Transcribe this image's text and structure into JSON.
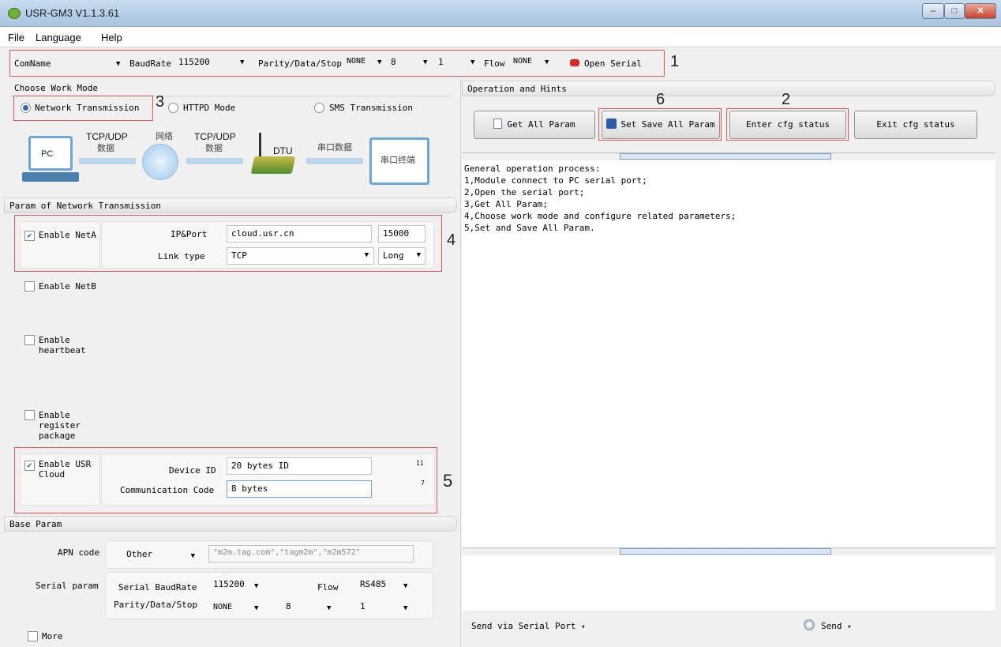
{
  "window": {
    "title": "USR-GM3 V1.1.3.61",
    "min": "–",
    "max": "□",
    "close": "✕"
  },
  "menu": [
    "File",
    "Language",
    "Help"
  ],
  "toolbar": {
    "comname_label": "ComName",
    "comname_value": "",
    "baudrate_label": "BaudRate",
    "baudrate_value": "115200",
    "parity_label": "Parity/Data/Stop",
    "parity_value": "NONE",
    "data_value": "8",
    "stop_value": "1",
    "flow_label": "Flow",
    "flow_value": "NONE",
    "open_serial": "Open Serial",
    "status_color": "#d42a2a"
  },
  "callouts": {
    "c1": "1",
    "c2": "2",
    "c3": "3",
    "c4": "4",
    "c5": "5",
    "c6": "6"
  },
  "workmode": {
    "header": "Choose Work Mode",
    "network": "Network Transmission",
    "httpd": "HTTPD Mode",
    "sms": "SMS Transmission",
    "selected": "network"
  },
  "diagram": {
    "pc": "PC",
    "tcp1": "TCP/UDP",
    "data1": "数据",
    "net": "网络",
    "tcp2": "TCP/UDP",
    "data2": "数据",
    "dtu": "DTU",
    "serial_data": "串口数据",
    "terminal": "串口终端"
  },
  "net_params": {
    "header": "Param of Network Transmission",
    "neta_label": "Enable NetA",
    "neta_checked": true,
    "ipport_label": "IP&Port",
    "ip_value": "cloud.usr.cn",
    "port_value": "15000",
    "linktype_label": "Link type",
    "linktype_value": "TCP",
    "link_mode": "Long",
    "netb_label": "Enable NetB",
    "heartbeat_label1": "Enable",
    "heartbeat_label2": "heartbeat",
    "reg_label1": "Enable",
    "reg_label2": "register",
    "reg_label3": "package",
    "cloud_label1": "Enable USR",
    "cloud_label2": "Cloud",
    "cloud_checked": true,
    "deviceid_label": "Device ID",
    "deviceid_value": "20 bytes ID",
    "deviceid_count": "11",
    "comm_label": "Communication Code",
    "comm_value": "8 bytes",
    "comm_count": "7"
  },
  "base_params": {
    "header": "Base Param",
    "apn_label": "APN code",
    "apn_value": "Other",
    "apn_hint": "\"m2m.tag.com\",\"tagm2m\",\"m2m572\"",
    "serial_label": "Serial param",
    "serial_baud_label": "Serial BaudRate",
    "serial_baud_value": "115200",
    "flow_label": "Flow",
    "flow_value": "RS485",
    "pds_label": "Parity/Data/Stop",
    "parity": "NONE",
    "data": "8",
    "stop": "1",
    "more_label": "More"
  },
  "operations": {
    "header": "Operation and Hints",
    "get_all": "Get All Param",
    "set_save": "Set Save All Param",
    "enter_cfg": "Enter cfg status",
    "exit_cfg": "Exit cfg status",
    "hints": [
      "General operation process:",
      "1,Module connect to PC serial port;",
      "2,Open the serial port;",
      "3,Get All Param;",
      "4,Choose work mode and configure related parameters;",
      "5,Set and Save All Param."
    ],
    "send_via": "Send via Serial Port",
    "send": "Send"
  }
}
